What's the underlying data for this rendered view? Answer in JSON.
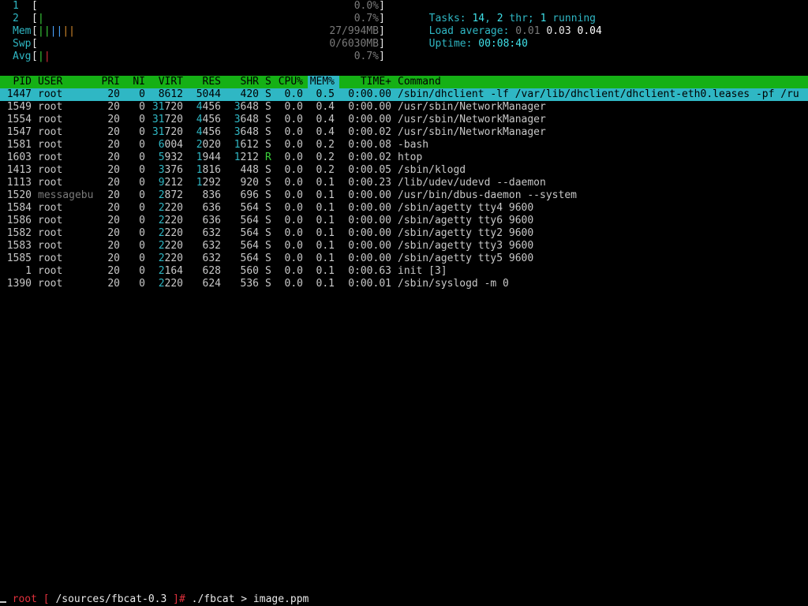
{
  "meters": [
    {
      "label": "1",
      "value": "0.0%",
      "bars": []
    },
    {
      "label": "2",
      "value": "0.7%",
      "bars": [
        {
          "c": "green",
          "t": "|"
        }
      ]
    },
    {
      "label": "Mem",
      "value": "27/994MB",
      "bars": [
        {
          "c": "green",
          "t": "|"
        },
        {
          "c": "green",
          "t": "|"
        },
        {
          "c": "blue",
          "t": "|"
        },
        {
          "c": "blue",
          "t": "|"
        },
        {
          "c": "orange",
          "t": "|"
        },
        {
          "c": "orange",
          "t": "|"
        }
      ]
    },
    {
      "label": "Swp",
      "value": "0/6030MB",
      "bars": []
    },
    {
      "label": "Avg",
      "value": "0.7%",
      "bars": [
        {
          "c": "green",
          "t": "|"
        },
        {
          "c": "red",
          "t": "|"
        }
      ]
    }
  ],
  "summary": {
    "tasks_label": "Tasks: ",
    "tasks_count": "14",
    "thr_sep": ", ",
    "thr_count": "2",
    "thr_label": " thr; ",
    "running_count": "1",
    "running_label": " running",
    "load_label": "Load average: ",
    "load1": "0.01",
    "load5": "0.03",
    "load15": "0.04",
    "uptime_label": "Uptime: ",
    "uptime": "00:08:40"
  },
  "columns": {
    "pid": "PID",
    "user": "USER",
    "pri": "PRI",
    "ni": "NI",
    "virt": "VIRT",
    "res": "RES",
    "shr": "SHR",
    "s": "S",
    "cpu": "CPU%",
    "mem": "MEM%",
    "time": "TIME+",
    "command": "Command"
  },
  "processes": [
    {
      "pid": "1447",
      "user": "root",
      "pri": "20",
      "ni": "0",
      "virt": "8612",
      "res": "5044",
      "shr": "420",
      "s": "S",
      "cpu": "0.0",
      "mem": "0.5",
      "time": "0:00.00",
      "cmd": "/sbin/dhclient -lf /var/lib/dhclient/dhclient-eth0.leases -pf /ru",
      "selected": true
    },
    {
      "pid": "1549",
      "user": "root",
      "pri": "20",
      "ni": "0",
      "virt": "31720",
      "res": "4456",
      "shr": "3648",
      "s": "S",
      "cpu": "0.0",
      "mem": "0.4",
      "time": "0:00.00",
      "cmd": "/usr/sbin/NetworkManager"
    },
    {
      "pid": "1554",
      "user": "root",
      "pri": "20",
      "ni": "0",
      "virt": "31720",
      "res": "4456",
      "shr": "3648",
      "s": "S",
      "cpu": "0.0",
      "mem": "0.4",
      "time": "0:00.00",
      "cmd": "/usr/sbin/NetworkManager"
    },
    {
      "pid": "1547",
      "user": "root",
      "pri": "20",
      "ni": "0",
      "virt": "31720",
      "res": "4456",
      "shr": "3648",
      "s": "S",
      "cpu": "0.0",
      "mem": "0.4",
      "time": "0:00.02",
      "cmd": "/usr/sbin/NetworkManager"
    },
    {
      "pid": "1581",
      "user": "root",
      "pri": "20",
      "ni": "0",
      "virt": "6004",
      "res": "2020",
      "shr": "1612",
      "s": "S",
      "cpu": "0.0",
      "mem": "0.2",
      "time": "0:00.08",
      "cmd": "-bash"
    },
    {
      "pid": "1603",
      "user": "root",
      "pri": "20",
      "ni": "0",
      "virt": "5932",
      "res": "1944",
      "shr": "1212",
      "s": "R",
      "cpu": "0.0",
      "mem": "0.2",
      "time": "0:00.02",
      "cmd": "htop"
    },
    {
      "pid": "1413",
      "user": "root",
      "pri": "20",
      "ni": "0",
      "virt": "3376",
      "res": "1816",
      "shr": "448",
      "s": "S",
      "cpu": "0.0",
      "mem": "0.2",
      "time": "0:00.05",
      "cmd": "/sbin/klogd"
    },
    {
      "pid": "1113",
      "user": "root",
      "pri": "20",
      "ni": "0",
      "virt": "9212",
      "res": "1292",
      "shr": "920",
      "s": "S",
      "cpu": "0.0",
      "mem": "0.1",
      "time": "0:00.23",
      "cmd": "/lib/udev/udevd --daemon"
    },
    {
      "pid": "1520",
      "user": "messagebu",
      "pri": "20",
      "ni": "0",
      "virt": "2872",
      "res": "836",
      "shr": "696",
      "s": "S",
      "cpu": "0.0",
      "mem": "0.1",
      "time": "0:00.00",
      "cmd": "/usr/bin/dbus-daemon --system",
      "dimuser": true
    },
    {
      "pid": "1584",
      "user": "root",
      "pri": "20",
      "ni": "0",
      "virt": "2220",
      "res": "636",
      "shr": "564",
      "s": "S",
      "cpu": "0.0",
      "mem": "0.1",
      "time": "0:00.00",
      "cmd": "/sbin/agetty tty4 9600"
    },
    {
      "pid": "1586",
      "user": "root",
      "pri": "20",
      "ni": "0",
      "virt": "2220",
      "res": "636",
      "shr": "564",
      "s": "S",
      "cpu": "0.0",
      "mem": "0.1",
      "time": "0:00.00",
      "cmd": "/sbin/agetty tty6 9600"
    },
    {
      "pid": "1582",
      "user": "root",
      "pri": "20",
      "ni": "0",
      "virt": "2220",
      "res": "632",
      "shr": "564",
      "s": "S",
      "cpu": "0.0",
      "mem": "0.1",
      "time": "0:00.00",
      "cmd": "/sbin/agetty tty2 9600"
    },
    {
      "pid": "1583",
      "user": "root",
      "pri": "20",
      "ni": "0",
      "virt": "2220",
      "res": "632",
      "shr": "564",
      "s": "S",
      "cpu": "0.0",
      "mem": "0.1",
      "time": "0:00.00",
      "cmd": "/sbin/agetty tty3 9600"
    },
    {
      "pid": "1585",
      "user": "root",
      "pri": "20",
      "ni": "0",
      "virt": "2220",
      "res": "632",
      "shr": "564",
      "s": "S",
      "cpu": "0.0",
      "mem": "0.1",
      "time": "0:00.00",
      "cmd": "/sbin/agetty tty5 9600"
    },
    {
      "pid": "1",
      "user": "root",
      "pri": "20",
      "ni": "0",
      "virt": "2164",
      "res": "628",
      "shr": "560",
      "s": "S",
      "cpu": "0.0",
      "mem": "0.1",
      "time": "0:00.63",
      "cmd": "init [3]"
    },
    {
      "pid": "1390",
      "user": "root",
      "pri": "20",
      "ni": "0",
      "virt": "2220",
      "res": "624",
      "shr": "536",
      "s": "S",
      "cpu": "0.0",
      "mem": "0.1",
      "time": "0:00.01",
      "cmd": "/sbin/syslogd -m 0"
    }
  ],
  "prompt": {
    "user": "root",
    "open": " [ ",
    "path": "/sources/fbcat-0.3",
    "close": " ]# ",
    "command": "./fbcat > image.ppm"
  },
  "colors": {
    "header_bg": "#15b015",
    "selected_bg": "#2fb7c4",
    "accent_cyan": "#2fb7c4",
    "prompt_red": "#e0303c"
  }
}
